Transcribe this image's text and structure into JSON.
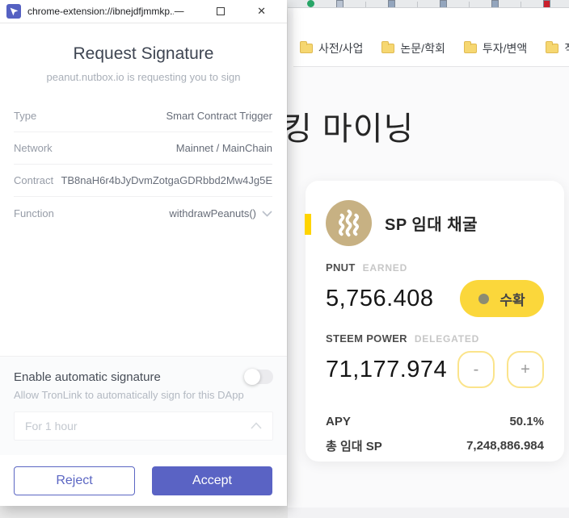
{
  "popup": {
    "titlebar": {
      "title": "chrome-extension://ibnejdfjmmkp...",
      "minimize_glyph": "—",
      "close_glyph": "✕"
    },
    "header": {
      "title": "Request Signature",
      "subtitle": "peanut.nutbox.io is requesting you to sign"
    },
    "rows": [
      {
        "label": "Type",
        "value": "Smart Contract Trigger"
      },
      {
        "label": "Network",
        "value": "Mainnet / MainChain"
      },
      {
        "label": "Contract",
        "value": "TB8naH6r4bJyDvmZotgaGDRbbd2Mw4Jg5E"
      },
      {
        "label": "Function",
        "value": "withdrawPeanuts()"
      }
    ],
    "auto_sign": {
      "title": "Enable automatic signature",
      "description": "Allow TronLink to automatically sign for this DApp",
      "duration_value": "For 1 hour",
      "toggle_on": false
    },
    "buttons": {
      "reject": "Reject",
      "accept": "Accept"
    }
  },
  "page": {
    "bookmarks": [
      {
        "label": "사전/사업"
      },
      {
        "label": "논문/학회"
      },
      {
        "label": "투자/변액"
      },
      {
        "label": "직구"
      }
    ],
    "heading": "킹 마이닝",
    "card": {
      "title": "SP 임대 채굴",
      "earned": {
        "label": "PNUT",
        "sublabel": "EARNED",
        "value": "5,756.408",
        "harvest_button": "수확"
      },
      "delegated": {
        "label": "STEEM POWER",
        "sublabel": "DELEGATED",
        "value": "71,177.974",
        "minus": "-",
        "plus": "+"
      },
      "stats": [
        {
          "label": "APY",
          "value": "50.1%"
        },
        {
          "label": "총 임대 SP",
          "value": "7,248,886.984"
        }
      ]
    }
  },
  "tabstrip": {
    "items": [
      {
        "type": "fav",
        "shape": "circle",
        "color": "#27a567"
      },
      {
        "type": "fav",
        "shape": "square",
        "color": "#b9c3d2"
      },
      {
        "type": "sep"
      },
      {
        "type": "fav",
        "shape": "square",
        "color": "#93a5bd"
      },
      {
        "type": "sep"
      },
      {
        "type": "fav",
        "shape": "square",
        "color": "#93a5bd"
      },
      {
        "type": "sep"
      },
      {
        "type": "fav",
        "shape": "square",
        "color": "#93a5bd"
      },
      {
        "type": "sep"
      },
      {
        "type": "fav",
        "shape": "square",
        "color": "#ca1f2c"
      }
    ]
  },
  "colors": {
    "accent_purple": "#5a63c4",
    "harvest_yellow": "#fbd73b",
    "card_accent_yellow": "#ffd400",
    "stepper_border_yellow": "#fbe48b",
    "steem_logo_tan": "#c7b183",
    "tronlink_icon_blue": "#5561c2"
  }
}
